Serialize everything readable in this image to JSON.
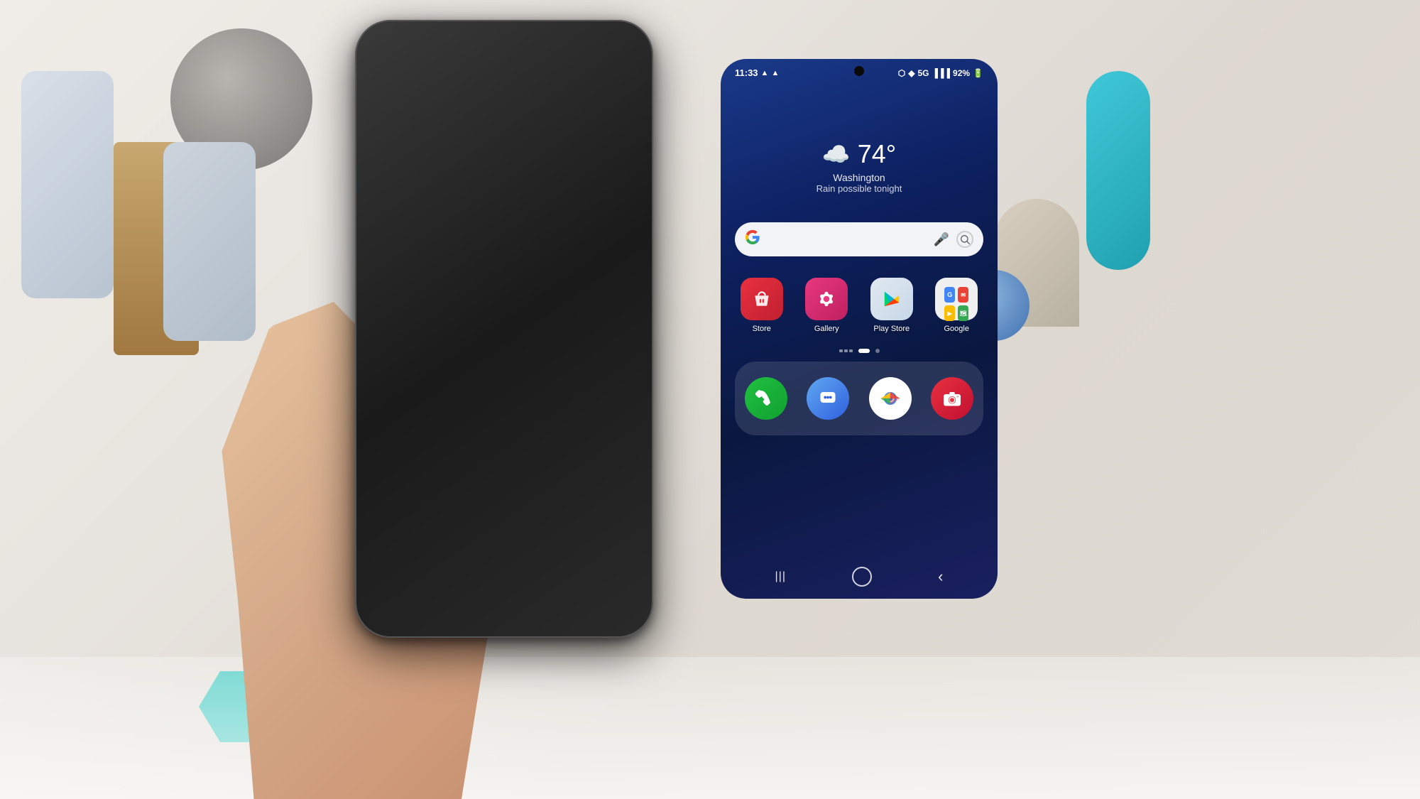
{
  "background": {
    "color": "#e8e0d8"
  },
  "phone": {
    "status_bar": {
      "time": "11:33",
      "battery": "92%",
      "signal": "5G",
      "icons": [
        "alert-icon",
        "wifi-icon",
        "nfc-icon",
        "signal-icon",
        "battery-icon"
      ]
    },
    "weather": {
      "temperature": "74°",
      "city": "Washington",
      "description": "Rain possible tonight",
      "icon": "☁️"
    },
    "search": {
      "placeholder": "",
      "g_label": "G",
      "mic_icon": "mic",
      "lens_icon": "lens"
    },
    "apps_row1": [
      {
        "id": "store",
        "label": "Store",
        "icon_type": "store"
      },
      {
        "id": "gallery",
        "label": "Gallery",
        "icon_type": "gallery"
      },
      {
        "id": "playstore",
        "label": "Play Store",
        "icon_type": "playstore"
      },
      {
        "id": "google",
        "label": "Google",
        "icon_type": "google"
      }
    ],
    "apps_dock": [
      {
        "id": "phone",
        "label": "",
        "icon_type": "phone"
      },
      {
        "id": "messages",
        "label": "",
        "icon_type": "messages"
      },
      {
        "id": "chrome",
        "label": "",
        "icon_type": "chrome"
      },
      {
        "id": "camera",
        "label": "",
        "icon_type": "camera"
      }
    ],
    "nav": {
      "recents_label": "|||",
      "home_label": "○",
      "back_label": "‹"
    },
    "page_indicator": {
      "dots": [
        "lines",
        "active",
        "inactive"
      ]
    }
  }
}
